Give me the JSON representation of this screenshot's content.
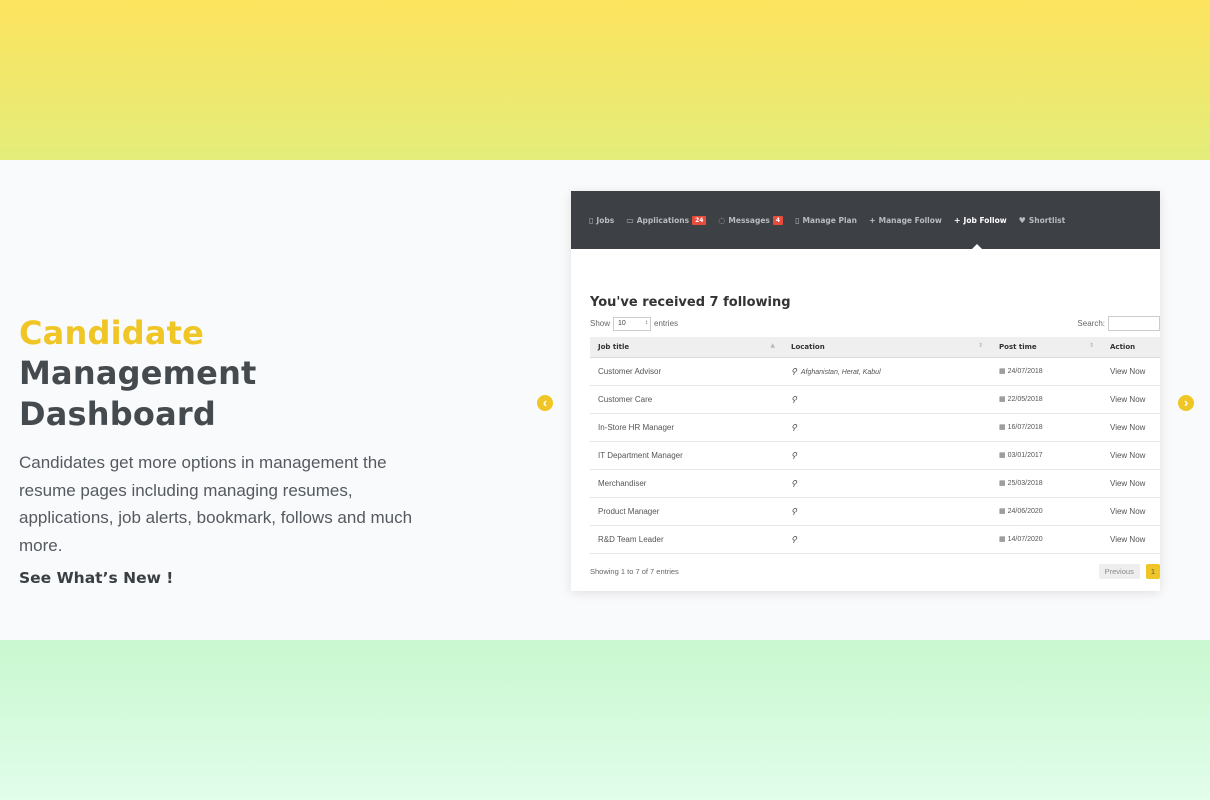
{
  "hero": {
    "title_accent": "Candidate",
    "title_line2": "Management",
    "title_line3": "Dashboard",
    "description": "Candidates get more options in management the resume pages including managing resumes, applications, job alerts, bookmark, follows and much more.",
    "cta": "See What’s New !"
  },
  "carousel": {
    "prev_icon": "chevron-left-icon",
    "next_icon": "chevron-right-icon"
  },
  "dashboard": {
    "nav": [
      {
        "label": "Jobs",
        "icon": "file-icon"
      },
      {
        "label": "Applications",
        "icon": "card-icon",
        "badge": "24"
      },
      {
        "label": "Messages",
        "icon": "chat-icon",
        "badge": "4"
      },
      {
        "label": "Manage Plan",
        "icon": "file-icon"
      },
      {
        "label": "Manage Follow",
        "icon": "plus-icon"
      },
      {
        "label": "Job Follow",
        "icon": "plus-icon",
        "active": true
      },
      {
        "label": "Shortlist",
        "icon": "heart-icon"
      }
    ],
    "heading": "You've received 7 following",
    "show_label": "Show",
    "show_value": "10",
    "entries_label": "entries",
    "search_label": "Search:",
    "columns": [
      "Job title",
      "Location",
      "Post time",
      "Action"
    ],
    "rows": [
      {
        "title": "Customer Advisor",
        "location": "Afghanistan, Herat, Kabul",
        "date": "24/07/2018",
        "action": "View Now"
      },
      {
        "title": "Customer Care",
        "location": "",
        "date": "22/05/2018",
        "action": "View Now"
      },
      {
        "title": "In-Store HR Manager",
        "location": "",
        "date": "16/07/2018",
        "action": "View Now"
      },
      {
        "title": "IT Department Manager",
        "location": "",
        "date": "03/01/2017",
        "action": "View Now"
      },
      {
        "title": "Merchandiser",
        "location": "",
        "date": "25/03/2018",
        "action": "View Now"
      },
      {
        "title": "Product Manager",
        "location": "",
        "date": "24/06/2020",
        "action": "View Now"
      },
      {
        "title": "R&D Team Leader",
        "location": "",
        "date": "14/07/2020",
        "action": "View Now"
      }
    ],
    "info": "Showing 1 to 7 of 7 entries",
    "prev_label": "Previous",
    "page": "1"
  },
  "colors": {
    "accent": "#f0c626",
    "nav_bg": "#3d4145",
    "badge": "#e74c3c"
  }
}
